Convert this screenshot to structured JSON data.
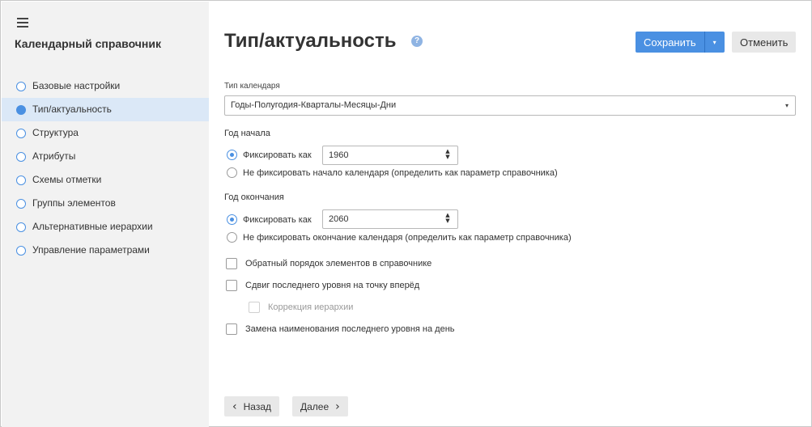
{
  "sidebar": {
    "title": "Календарный справочник",
    "items": [
      {
        "label": "Базовые настройки",
        "active": false
      },
      {
        "label": "Тип/актуальность",
        "active": true
      },
      {
        "label": "Структура",
        "active": false
      },
      {
        "label": "Атрибуты",
        "active": false
      },
      {
        "label": "Схемы отметки",
        "active": false
      },
      {
        "label": "Группы элементов",
        "active": false
      },
      {
        "label": "Альтернативные иерархии",
        "active": false
      },
      {
        "label": "Управление параметрами",
        "active": false
      }
    ]
  },
  "header": {
    "title": "Тип/актуальность",
    "help_icon": "?",
    "save_label": "Сохранить",
    "save_dropdown_icon": "▾",
    "cancel_label": "Отменить"
  },
  "calendar_type": {
    "label": "Тип календаря",
    "value": "Годы-Полугодия-Кварталы-Месяцы-Дни",
    "arrow": "▾"
  },
  "start_year": {
    "label": "Год начала",
    "fix_label": "Фиксировать как",
    "fix_value": "1960",
    "nofix_label": "Не фиксировать начало календаря (определить как параметр справочника)"
  },
  "end_year": {
    "label": "Год окончания",
    "fix_label": "Фиксировать как",
    "fix_value": "2060",
    "nofix_label": "Не фиксировать окончание календаря (определить как параметр справочника)"
  },
  "options": {
    "reverse_order": "Обратный порядок элементов в справочнике",
    "shift_last_level": "Сдвиг последнего уровня на точку вперёд",
    "hierarchy_correction": "Коррекция иерархии",
    "rename_last_level": "Замена наименования последнего уровня на день"
  },
  "footer": {
    "back_label": "Назад",
    "next_label": "Далее"
  },
  "colors": {
    "accent": "#4a90e2",
    "sidebar_bg": "#f2f2f2",
    "active_item_bg": "#dbe8f7"
  }
}
